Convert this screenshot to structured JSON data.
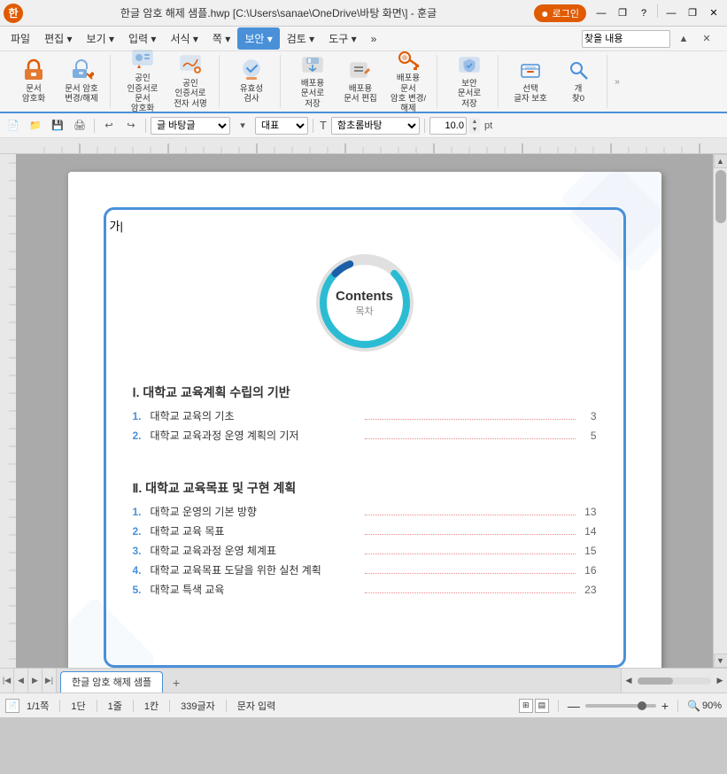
{
  "titlebar": {
    "app_icon_label": "한",
    "title": "한글 암호 해제 샘플.hwp [C:\\Users\\sanae\\OneDrive\\바탕 화면\\] - 훈글",
    "login_label": "로그인",
    "minimize_icon": "—",
    "restore_icon": "❐",
    "close_icon": "✕",
    "help_icon": "?"
  },
  "menubar": {
    "items": [
      {
        "label": "파일"
      },
      {
        "label": "편집"
      },
      {
        "label": "보기"
      },
      {
        "label": "입력"
      },
      {
        "label": "서식"
      },
      {
        "label": "쪽"
      },
      {
        "label": "보안",
        "active": true
      },
      {
        "label": "검토"
      },
      {
        "label": "도구"
      },
      {
        "label": "»"
      },
      {
        "label": "찾을 내용"
      }
    ]
  },
  "ribbon": {
    "groups": [
      {
        "buttons": [
          {
            "label": "문서\n암호화",
            "icon": "lock"
          },
          {
            "label": "문서 암호\n변경/해제",
            "icon": "lock-edit"
          }
        ]
      },
      {
        "buttons": [
          {
            "label": "공인 인증서로\n문서 암호화",
            "icon": "cert"
          },
          {
            "label": "공인 인증서로\n전자 서명",
            "icon": "sign"
          }
        ]
      },
      {
        "buttons": [
          {
            "label": "유효성\n검사",
            "icon": "check"
          }
        ]
      },
      {
        "buttons": [
          {
            "label": "배포용\n문서로 저장",
            "icon": "save-dist"
          },
          {
            "label": "배포용\n문서 편집",
            "icon": "edit-dist"
          },
          {
            "label": "배포용 문서\n암호 변경/해제",
            "icon": "key-dist"
          }
        ]
      },
      {
        "buttons": [
          {
            "label": "보안\n문서로 저장",
            "icon": "secure-save"
          }
        ]
      },
      {
        "buttons": [
          {
            "label": "선택\n글자 보호",
            "icon": "protect"
          },
          {
            "label": "개\n찾0",
            "icon": "find"
          }
        ]
      }
    ]
  },
  "formattingbar": {
    "style_select": "글 바탕글",
    "para_select": "대표",
    "font_select": "함초롬바탕",
    "font_size": "10.0",
    "font_size_unit": "pt"
  },
  "document": {
    "circle_title": "Contents",
    "circle_subtitle": "목차",
    "sections": [
      {
        "num": "Ⅰ",
        "title": "대학교 교육계획 수립의 기반",
        "items": [
          {
            "num": "1",
            "text": "대학교 교육의 기초",
            "page": "3"
          },
          {
            "num": "2",
            "text": "대학교 교육과정 운영 계획의 기저",
            "page": "5"
          }
        ]
      },
      {
        "num": "Ⅱ",
        "title": "대학교 교육목표 및 구현 계획",
        "items": [
          {
            "num": "1",
            "text": "대학교 운영의 기본 방향",
            "page": "13"
          },
          {
            "num": "2",
            "text": "대학교 교육 목표",
            "page": "14"
          },
          {
            "num": "3",
            "text": "대학교 교육과정 운영 체계표",
            "page": "15"
          },
          {
            "num": "4",
            "text": "대학교 교육목표 도달을 위한 실천 계획",
            "page": "16"
          },
          {
            "num": "5",
            "text": "대학교 특색 교육",
            "page": "23"
          }
        ]
      }
    ]
  },
  "tabbar": {
    "tabs": [
      {
        "label": "한글 암호 해제 샘플",
        "active": true
      }
    ],
    "add_icon": "+"
  },
  "statusbar": {
    "page": "1/1쪽",
    "section": "1단",
    "line": "1줄",
    "col": "1칸",
    "chars": "339글자",
    "mode": "문자 입력",
    "zoom": "90%"
  }
}
